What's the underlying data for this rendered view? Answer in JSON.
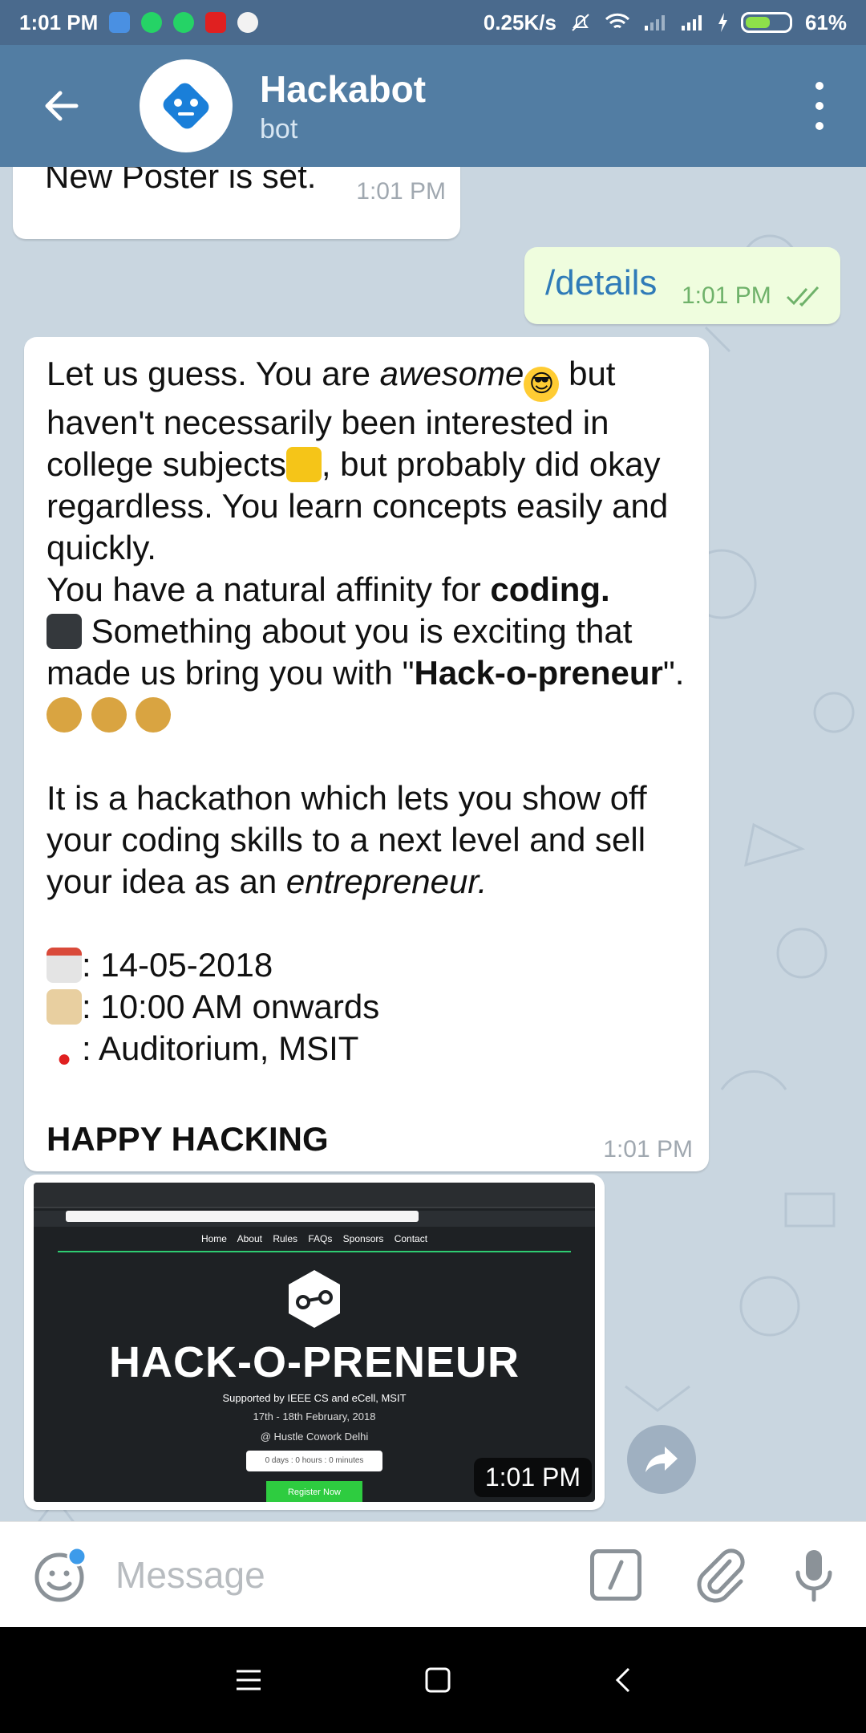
{
  "status_bar": {
    "time": "1:01 PM",
    "net_speed": "0.25K/s",
    "battery": "61%",
    "battery_level": 0.61
  },
  "header": {
    "title": "Hackabot",
    "subtitle": "bot"
  },
  "messages": {
    "m1": {
      "text": "New Poster is set.",
      "time": "1:01 PM"
    },
    "m2": {
      "text": "/details",
      "time": "1:01 PM"
    },
    "m3": {
      "p1a": "Let us guess. You are ",
      "p1b": "awesome",
      "p1c": " but haven't necessarily been interested in college subjects",
      "p1d": ", but probably did okay regardless. You learn concepts easily and quickly.",
      "p2a": "You have a natural affinity for ",
      "p2b": "coding.",
      "p2c": " Something  about you is exciting that made us bring you with \"",
      "p2d": "Hack-o-preneur",
      "p2e": "\". ",
      "p3a": "It is a hackathon which lets you show off your coding skills to a next level and sell your idea as an ",
      "p3b": "entrepreneur.",
      "date": ": 14-05-2018",
      "time_info": ": 10:00 AM onwards",
      "venue": ": Auditorium, MSIT",
      "closing": "HAPPY HACKING",
      "time": "1:01 PM"
    },
    "m4": {
      "nav": "Home About Rules FAQs Sponsors Contact",
      "title": "HACK-O-PRENEUR",
      "supported": "Supported by IEEE CS and eCell, MSIT",
      "dates": "17th - 18th February, 2018",
      "venue": "@ Hustle Cowork Delhi",
      "timer": "0 days : 0 hours : 0 minutes",
      "register": "Register Now",
      "time": "1:01 PM"
    }
  },
  "input": {
    "placeholder": "Message"
  },
  "colors": {
    "appbar": "#527da3",
    "statusbar": "#4a6a8d",
    "chat_bg": "#c9d6e0",
    "outgoing_bubble": "#effdde",
    "link": "#2f7bb8"
  },
  "icons": [
    "back-arrow-icon",
    "bot-avatar-icon",
    "more-vert-icon",
    "emoji-icon",
    "slash-command-icon",
    "attach-icon",
    "mic-icon",
    "share-icon",
    "menu-icon",
    "home-icon",
    "nav-back-icon"
  ]
}
